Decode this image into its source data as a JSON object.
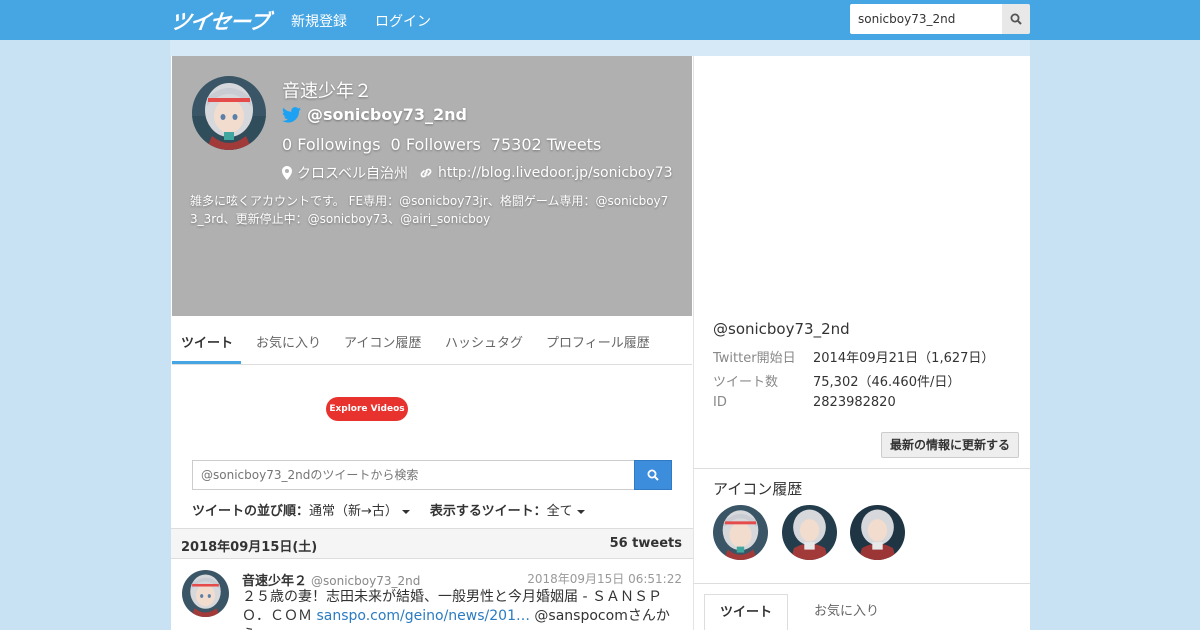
{
  "nav": {
    "logo": "ツイセーブ",
    "signup": "新規登録",
    "login": "ログイン",
    "search_value": "sonicboy73_2nd"
  },
  "profile": {
    "name": "音速少年２",
    "handle": "@sonicboy73_2nd",
    "followings_count": "0",
    "followings_label": "Followings",
    "followers_count": "0",
    "followers_label": "Followers",
    "tweets_count": "75302",
    "tweets_label": "Tweets",
    "location": "クロスベル自治州",
    "url": "http://blog.livedoor.jp/sonicboy73",
    "bio": "雑多に呟くアカウントです。 FE専用：@sonicboy73jr、格闘ゲーム専用：@sonicboy73_3rd、更新停止中：@sonicboy73、@airi_sonicboy"
  },
  "tabs": [
    "ツイート",
    "お気に入り",
    "アイコン履歴",
    "ハッシュタグ",
    "プロフィール履歴"
  ],
  "ad": {
    "label": "Explore Videos"
  },
  "tweet_search": {
    "placeholder": "@sonicboy73_2ndのツイートから検索"
  },
  "sort": {
    "order_label": "ツイートの並び順：",
    "order_value": "通常（新→古）",
    "filter_label": "表示するツイート：",
    "filter_value": "全て"
  },
  "date_bar": {
    "date": "2018年09月15日(土)",
    "count": "56 tweets"
  },
  "tweet": {
    "name": "音速少年２",
    "screen": "@sonicboy73_2nd",
    "time": "2018年09月15日 06:51:22",
    "text_before": "２５歳の妻！志田未来が結婚、一般男性と今月婚姻届 - ＳＡＮＳＰＯ．ＣＯＭ ",
    "link": "sanspo.com/geino/news/201…",
    "text_after": " @sanspocomさんから"
  },
  "account_info": {
    "handle": "@sonicboy73_2nd",
    "rows": [
      {
        "key": "Twitter開始日",
        "value": "2014年09月21日（1,627日）"
      },
      {
        "key": "ツイート数",
        "value": "75,302（46.460件/日）"
      },
      {
        "key": "ID",
        "value": "2823982820"
      }
    ],
    "update_button": "最新の情報に更新する"
  },
  "icon_history": {
    "title": "アイコン履歴"
  },
  "right_tabs": [
    "ツイート",
    "お気に入り"
  ],
  "colors": {
    "navbar": "#46a5e3",
    "background": "#c8e1f3",
    "header_gray": "#b0b0b0",
    "search_button": "#3c8ddb",
    "ad_red": "#e8322e"
  }
}
